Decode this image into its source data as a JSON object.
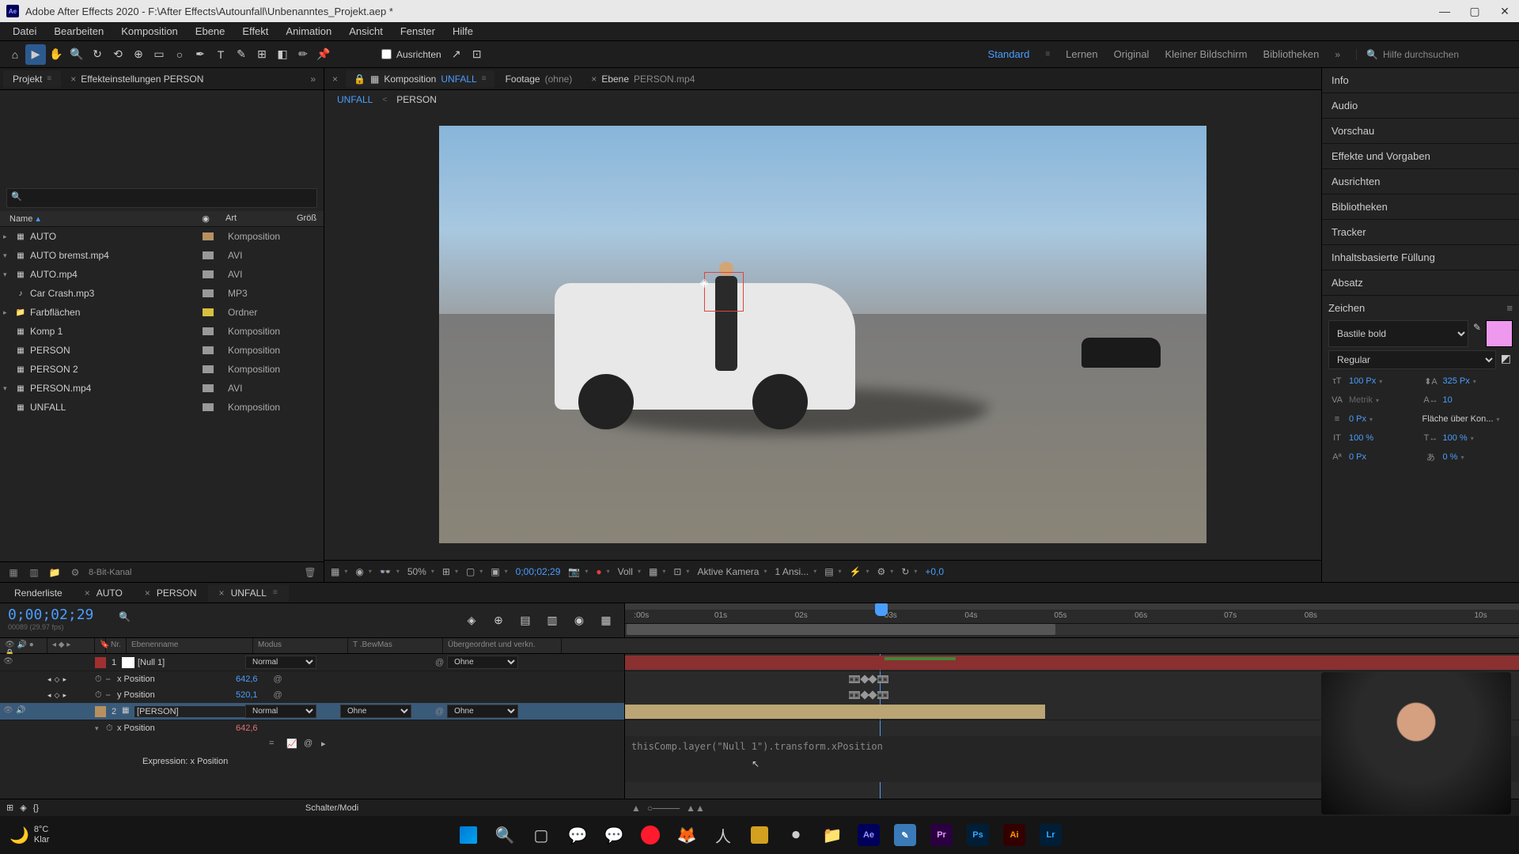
{
  "title": "Adobe After Effects 2020 - F:\\After Effects\\Autounfall\\Unbenanntes_Projekt.aep *",
  "menu": [
    "Datei",
    "Bearbeiten",
    "Komposition",
    "Ebene",
    "Effekt",
    "Animation",
    "Ansicht",
    "Fenster",
    "Hilfe"
  ],
  "toolbar": {
    "align_label": "Ausrichten",
    "search_help": "Hilfe durchsuchen"
  },
  "workspaces": {
    "items": [
      "Standard",
      "Lernen",
      "Original",
      "Kleiner Bildschirm",
      "Bibliotheken"
    ],
    "active": "Standard"
  },
  "project": {
    "tab_project": "Projekt",
    "tab_effects": "Effekteinstellungen PERSON",
    "headers": {
      "name": "Name",
      "art": "Art",
      "size": "Größ"
    },
    "items": [
      {
        "name": "AUTO",
        "color": "#b89060",
        "art": "Komposition",
        "icon": "▦",
        "expand": "▸"
      },
      {
        "name": "AUTO bremst.mp4",
        "color": "#999999",
        "art": "AVI",
        "icon": "▦",
        "expand": "▾"
      },
      {
        "name": "AUTO.mp4",
        "color": "#999999",
        "art": "AVI",
        "icon": "▦",
        "expand": "▾"
      },
      {
        "name": "Car Crash.mp3",
        "color": "#999999",
        "art": "MP3",
        "icon": "♪",
        "expand": ""
      },
      {
        "name": "Farbflächen",
        "color": "#d6c040",
        "art": "Ordner",
        "icon": "📁",
        "expand": "▸"
      },
      {
        "name": "Komp 1",
        "color": "#999999",
        "art": "Komposition",
        "icon": "▦",
        "expand": ""
      },
      {
        "name": "PERSON",
        "color": "#999999",
        "art": "Komposition",
        "icon": "▦",
        "expand": ""
      },
      {
        "name": "PERSON 2",
        "color": "#999999",
        "art": "Komposition",
        "icon": "▦",
        "expand": ""
      },
      {
        "name": "PERSON.mp4",
        "color": "#999999",
        "art": "AVI",
        "icon": "▦",
        "expand": "▾"
      },
      {
        "name": "UNFALL",
        "color": "#999999",
        "art": "Komposition",
        "icon": "▦",
        "expand": ""
      }
    ],
    "footer_label": "8-Bit-Kanal"
  },
  "comp": {
    "tabs": [
      {
        "label": "Komposition",
        "name": "UNFALL",
        "active": true
      },
      {
        "label": "Footage",
        "name": "(ohne)",
        "active": false
      },
      {
        "label": "Ebene",
        "name": "PERSON.mp4",
        "active": false
      }
    ],
    "crumbs": [
      "UNFALL",
      "PERSON"
    ],
    "footer": {
      "zoom": "50%",
      "timecode": "0;00;02;29",
      "res": "Voll",
      "camera": "Aktive Kamera",
      "views": "1 Ansi...",
      "offset": "+0,0"
    }
  },
  "right_panels": [
    "Info",
    "Audio",
    "Vorschau",
    "Effekte und Vorgaben",
    "Ausrichten",
    "Bibliotheken",
    "Tracker",
    "Inhaltsbasierte Füllung",
    "Absatz"
  ],
  "zeichen": {
    "title": "Zeichen",
    "font": "Bastile bold",
    "style": "Regular",
    "size": "100 Px",
    "leading": "325 Px",
    "tracking": "Metrik",
    "kerning": "10",
    "stroke": "0 Px",
    "fill_label": "Fläche über Kon...",
    "vscale": "100 %",
    "hscale": "100 %",
    "baseline": "0 Px",
    "tsume": "0 %",
    "color": "#ee99ee"
  },
  "timeline": {
    "tabs": [
      "Renderliste",
      "AUTO",
      "PERSON",
      "UNFALL"
    ],
    "active_tab": "UNFALL",
    "timecode": "0;00;02;29",
    "fps_label": "00089 (29.97 fps)",
    "ruler": [
      ":00s",
      "01s",
      "02s",
      "03s",
      "04s",
      "05s",
      "06s",
      "07s",
      "08s",
      "10s"
    ],
    "cols": {
      "nr": "Nr.",
      "name": "Ebenenname",
      "mode": "Modus",
      "trk": "T .BewMas",
      "parent": "Übergeordnet und verkn."
    },
    "layers": [
      {
        "num": "1",
        "name": "[Null 1]",
        "color": "#a03030",
        "mode": "Normal",
        "trk": "",
        "parent": "Ohne",
        "selected": false
      },
      {
        "num": "2",
        "name": "[PERSON]",
        "color": "#b89060",
        "mode": "Normal",
        "trk": "Ohne",
        "parent": "Ohne",
        "selected": true
      }
    ],
    "props": {
      "xpos": "x Position",
      "ypos": "y Position",
      "xpos_val": "642,6",
      "ypos_val": "520,1",
      "person_xpos_val": "642,6",
      "expr_label": "Expression: x Position",
      "expr_code": "thisComp.layer(\"Null 1\").transform.xPosition"
    },
    "footer_label": "Schalter/Modi"
  },
  "taskbar": {
    "temp": "8°C",
    "condition": "Klar"
  }
}
